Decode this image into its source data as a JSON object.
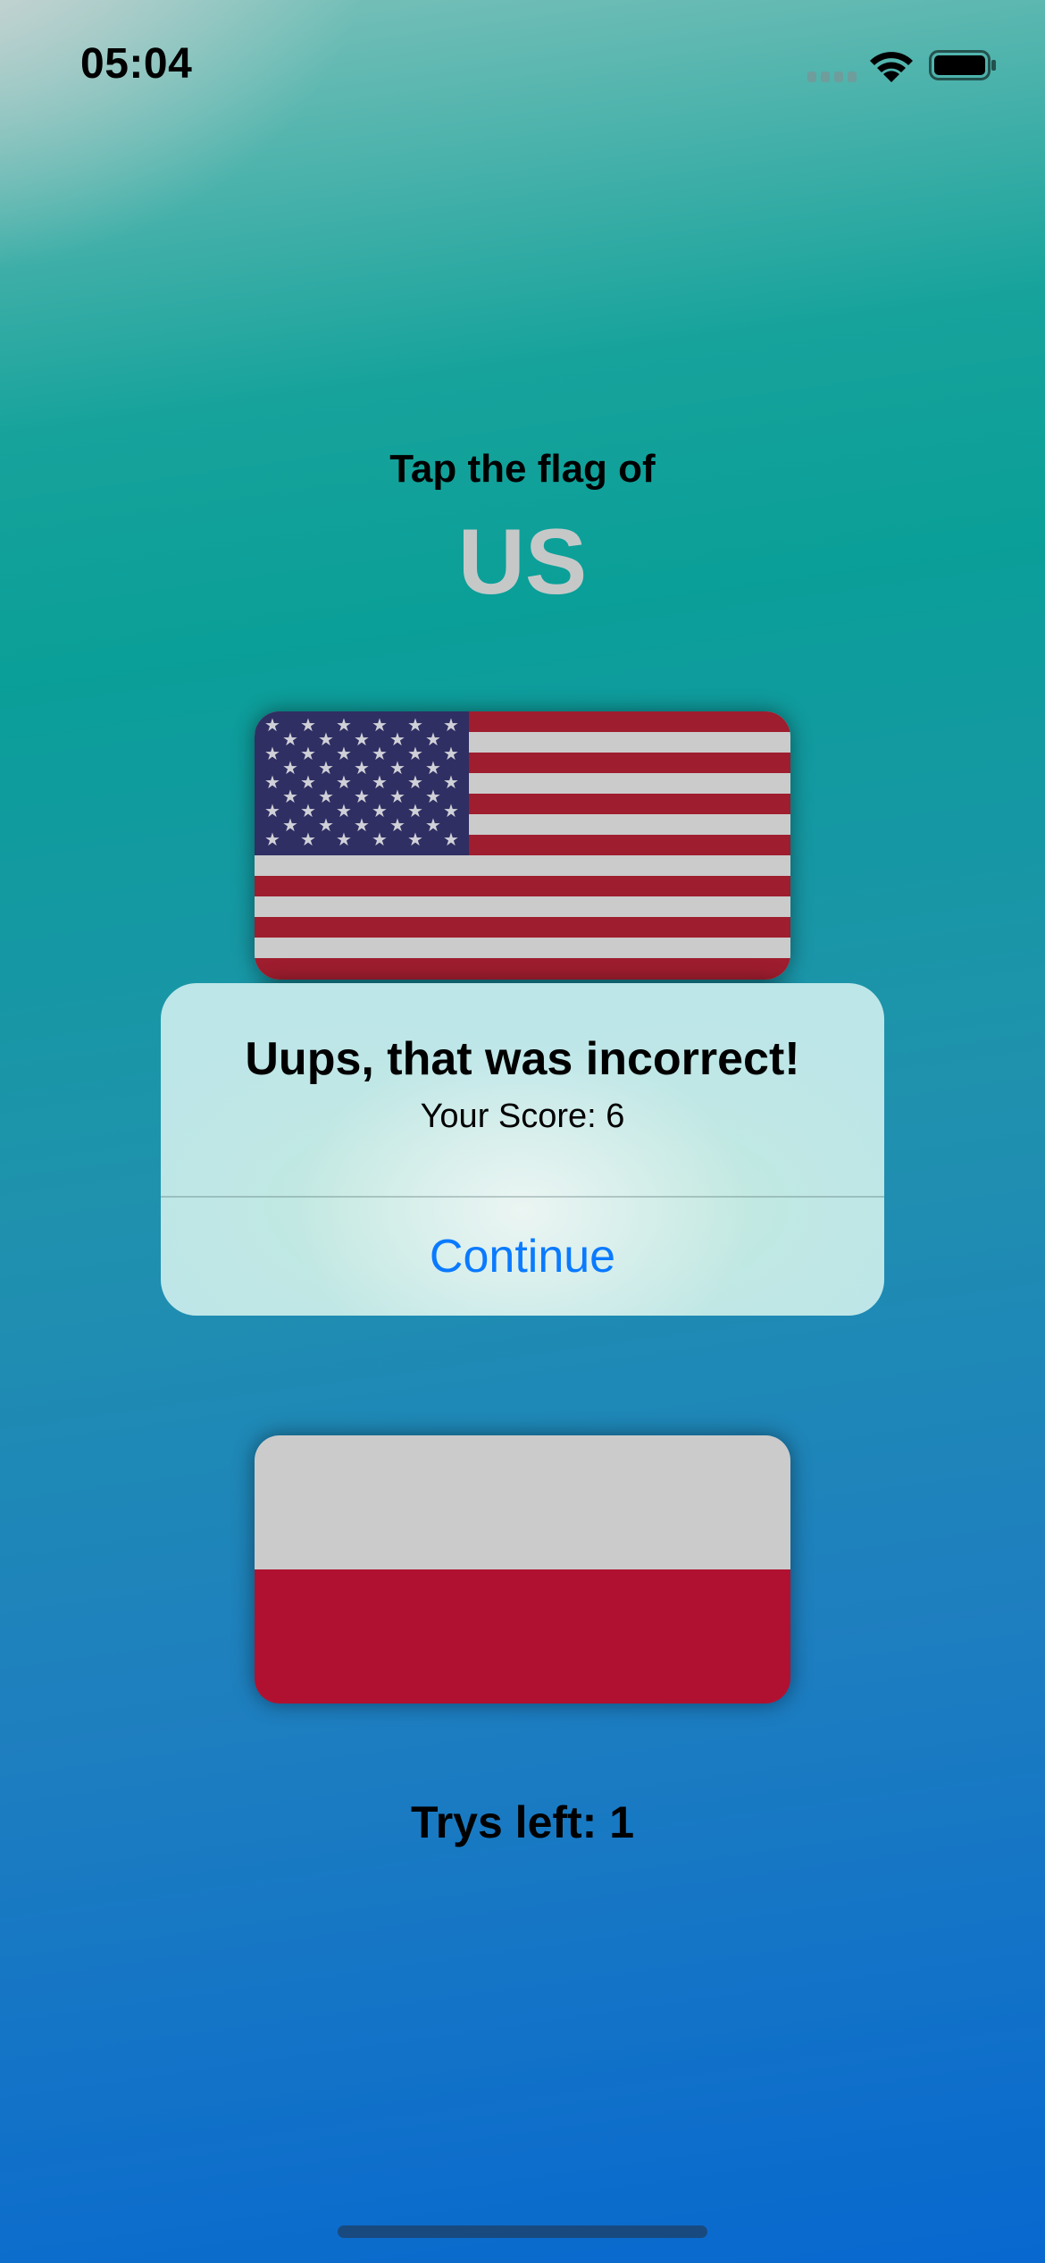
{
  "status_bar": {
    "time": "05:04"
  },
  "quiz": {
    "prompt": "Tap the flag of",
    "country": "US",
    "flags": [
      {
        "name": "flag-us"
      },
      {
        "name": "flag-mid"
      },
      {
        "name": "flag-poland"
      }
    ],
    "trys_left": "Trys left: 1"
  },
  "alert": {
    "title": "Uups, that was incorrect!",
    "message": "Your Score: 6",
    "button_label": "Continue"
  },
  "colors": {
    "accent": "#0a7aff",
    "country_text": "#c6c8c8",
    "us_red": "#9e1d2e",
    "us_blue": "#2f2f63",
    "pl_red": "#b01131",
    "flag_white": "#cbcbcb",
    "green": "#0a7a48"
  }
}
